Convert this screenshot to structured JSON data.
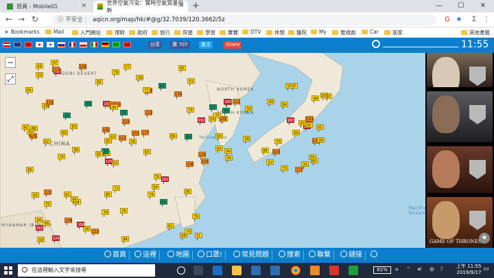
{
  "tabs": [
    {
      "title": "首頁 - Mobile01",
      "active": false
    },
    {
      "title": "世界空氣污染：實時空氣質量指數",
      "active": true
    }
  ],
  "address": {
    "security": "不安全",
    "url": "aqicn.org/map/hk/#@g/32.7039/120.3662/5z"
  },
  "bookmarks": [
    "Bookmarks",
    "Mail",
    "入門網站",
    "理財",
    "政府",
    "旅行",
    "房屋",
    "學習",
    "寶寶",
    "DTV",
    "休閒",
    "醫院",
    "My",
    "電視劇",
    "Car",
    "居家",
    "其他書籤"
  ],
  "sitebar": {
    "share1": "分享",
    "share2": "讚 707",
    "share3": "推文",
    "share4": "Share",
    "time": "11:55"
  },
  "map_labels": {
    "gobi": "GOBI DESERT",
    "china": "CHINA",
    "nkorea": "NORTH KOREA",
    "skorea": "SOUTH KOREA",
    "yellowsea": "Yellow Sea",
    "pacific": "Pacific Ocean",
    "myanmar": "MYANMAR (BURMA)"
  },
  "aqi_markers": [
    "53",
    "63",
    "81",
    "94",
    "105",
    "99",
    "111",
    "120",
    "144",
    "186",
    "163",
    "71",
    "62",
    "58",
    "90",
    "132",
    "174",
    "158",
    "122",
    "104",
    "93",
    "153",
    "104",
    "107",
    "101",
    "151",
    "118",
    "101",
    "120",
    "137",
    "152",
    "33",
    "76",
    "91",
    "84",
    "42",
    "86",
    "59",
    "76",
    "96",
    "77",
    "101",
    "69",
    "74",
    "75",
    "62",
    "58",
    "59",
    "64",
    "92",
    "75",
    "79",
    "59",
    "54",
    "85",
    "64",
    "112",
    "99",
    "76",
    "90",
    "79",
    "89",
    "54",
    "25",
    "100",
    "97",
    "59",
    "65",
    "63",
    "88",
    "80",
    "90",
    "76",
    "63",
    "52",
    "53",
    "75",
    "85",
    "106",
    "91",
    "122",
    "85",
    "63",
    "58",
    "117",
    "40",
    "72",
    "63",
    "84",
    "58",
    "154",
    "104",
    "137",
    "42",
    "60",
    "85",
    "88",
    "54",
    "77",
    "90",
    "74",
    "134",
    "120",
    "82",
    "70",
    "61",
    "156",
    "150",
    "134",
    "167",
    "108",
    "37",
    "68",
    "93",
    "59",
    "81",
    "170",
    "51",
    "49",
    "97",
    "122",
    "55",
    "25",
    "40",
    "53",
    "63",
    "70",
    "113",
    "86",
    "89"
  ],
  "ads": [
    {
      "name": "Daenerys card"
    },
    {
      "name": "Jon Snow card"
    },
    {
      "name": "Sansa card"
    },
    {
      "name": "Jaime card",
      "caption": "GAME OF THRONES"
    }
  ],
  "bottomnav": [
    "首頁",
    "這裡",
    "地圖",
    "口罩!",
    "常見問題",
    "搜索",
    "聯繫",
    "鏈接"
  ],
  "taskbar": {
    "search": "在這裡輸入文字來搜尋",
    "battery": "61%",
    "time": "上午 11:55",
    "date": "2019/9/17"
  }
}
